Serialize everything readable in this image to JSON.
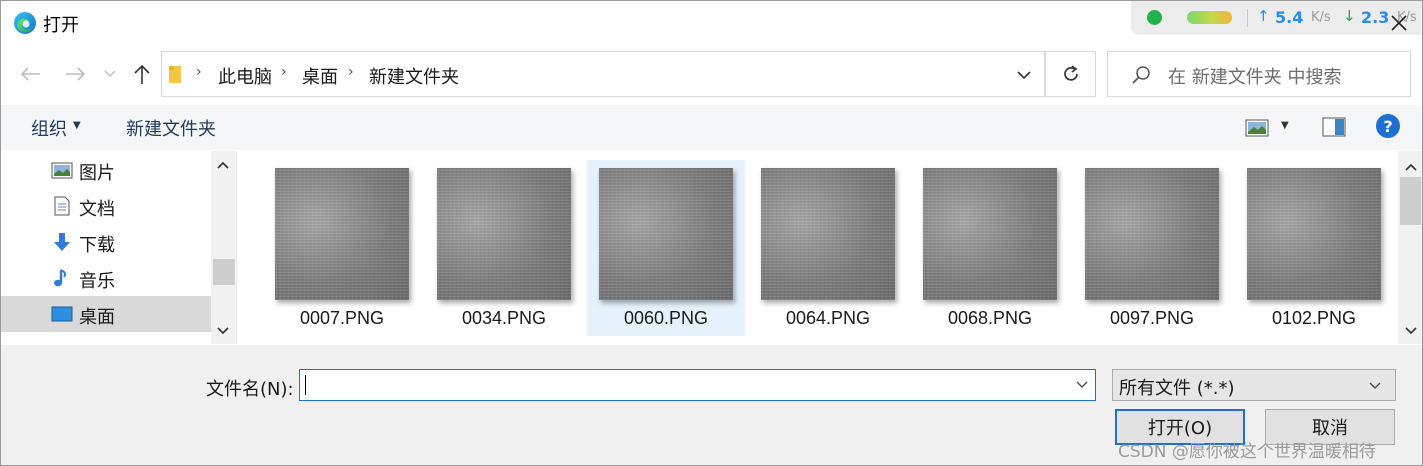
{
  "window": {
    "title": "打开"
  },
  "net_monitor": {
    "upload": "5.4",
    "upload_unit": "K/s",
    "download": "2.3",
    "download_unit": "K/s"
  },
  "address_bar": {
    "crumbs": [
      "此电脑",
      "桌面",
      "新建文件夹"
    ]
  },
  "search": {
    "placeholder": "在 新建文件夹 中搜索"
  },
  "toolbar": {
    "organize_label": "组织",
    "new_folder_label": "新建文件夹",
    "help_label": "?"
  },
  "nav_pane": {
    "items": [
      {
        "label": "图片",
        "icon": "pictures-icon",
        "selected": false
      },
      {
        "label": "文档",
        "icon": "documents-icon",
        "selected": false
      },
      {
        "label": "下载",
        "icon": "downloads-icon",
        "selected": false
      },
      {
        "label": "音乐",
        "icon": "music-icon",
        "selected": false
      },
      {
        "label": "桌面",
        "icon": "desktop-icon",
        "selected": true
      }
    ]
  },
  "files": [
    {
      "name": "0007.PNG",
      "selected": false
    },
    {
      "name": "0034.PNG",
      "selected": false
    },
    {
      "name": "0060.PNG",
      "selected": true
    },
    {
      "name": "0064.PNG",
      "selected": false
    },
    {
      "name": "0068.PNG",
      "selected": false
    },
    {
      "name": "0097.PNG",
      "selected": false
    },
    {
      "name": "0102.PNG",
      "selected": false
    }
  ],
  "footer": {
    "filename_label": "文件名(N):",
    "filename_value": "",
    "file_type": "所有文件 (*.*)",
    "open_label": "打开(O)",
    "cancel_label": "取消"
  },
  "watermark": "CSDN @愿你被这个世界温暖相待",
  "colors": {
    "accent": "#1f6fd1",
    "selection": "#e5f1fb",
    "nav_selected": "#d9d9d9"
  }
}
